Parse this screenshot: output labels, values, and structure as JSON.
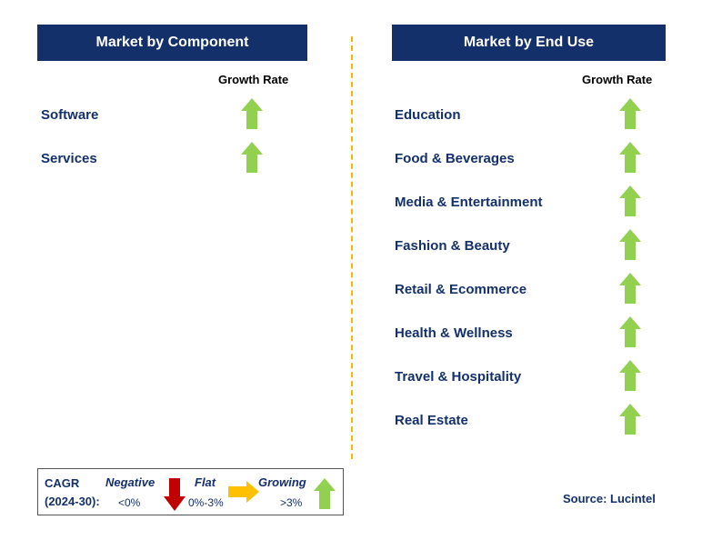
{
  "left": {
    "title": "Market by Component",
    "growth_label": "Growth Rate",
    "items": [
      {
        "label": "Software",
        "trend": "growing"
      },
      {
        "label": "Services",
        "trend": "growing"
      }
    ]
  },
  "right": {
    "title": "Market by End Use",
    "growth_label": "Growth Rate",
    "items": [
      {
        "label": "Education",
        "trend": "growing"
      },
      {
        "label": "Food & Beverages",
        "trend": "growing"
      },
      {
        "label": "Media & Entertainment",
        "trend": "growing"
      },
      {
        "label": "Fashion & Beauty",
        "trend": "growing"
      },
      {
        "label": "Retail & Ecommerce",
        "trend": "growing"
      },
      {
        "label": "Health & Wellness",
        "trend": "growing"
      },
      {
        "label": "Travel & Hospitality",
        "trend": "growing"
      },
      {
        "label": "Real Estate",
        "trend": "growing"
      }
    ]
  },
  "legend": {
    "cagr": "CAGR",
    "period": "(2024-30):",
    "negative": "Negative",
    "negative_range": "<0%",
    "flat": "Flat",
    "flat_range": "0%-3%",
    "growing": "Growing",
    "growing_range": ">3%"
  },
  "source": "Source: Lucintel",
  "colors": {
    "header": "#14306b",
    "growing": "#92d050",
    "flat": "#ffc000",
    "negative": "#c00000"
  }
}
